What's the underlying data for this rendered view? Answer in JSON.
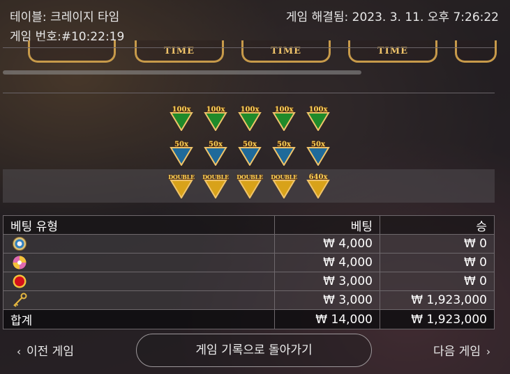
{
  "header": {
    "table_label": "테이블:",
    "table_name": "크레이지 타임",
    "game_no_label": "게임 번호:",
    "game_no": "#10:22:19",
    "resolved_label": "게임 해결됨:",
    "resolved_time": "2023. 3. 11. 오후 7:26:22"
  },
  "time_tiles": [
    "TIME",
    "TIME",
    "TIME"
  ],
  "flap_rows": [
    {
      "items": [
        {
          "label": "100x",
          "color": "#1f8a2a"
        },
        {
          "label": "100x",
          "color": "#1f8a2a"
        },
        {
          "label": "100x",
          "color": "#1f8a2a"
        },
        {
          "label": "100x",
          "color": "#1f8a2a"
        },
        {
          "label": "100x",
          "color": "#1f8a2a"
        }
      ]
    },
    {
      "items": [
        {
          "label": "50x",
          "color": "#1f6a9a"
        },
        {
          "label": "50x",
          "color": "#1f6a9a"
        },
        {
          "label": "50x",
          "color": "#1f6a9a"
        },
        {
          "label": "50x",
          "color": "#1f6a9a"
        },
        {
          "label": "50x",
          "color": "#1f6a9a"
        }
      ]
    },
    {
      "items": [
        {
          "label": "DOUBLE",
          "color": "#d8a21a"
        },
        {
          "label": "DOUBLE",
          "color": "#d8a21a"
        },
        {
          "label": "DOUBLE",
          "color": "#d8a21a"
        },
        {
          "label": "DOUBLE",
          "color": "#d8a21a"
        },
        {
          "label": "640x",
          "color": "#d8a21a"
        }
      ]
    }
  ],
  "bets_table": {
    "headers": {
      "type": "베팅 유형",
      "bet": "베팅",
      "win": "승"
    },
    "rows": [
      {
        "icon": "coin-flip-icon",
        "bet": "₩ 4,000",
        "win": "₩ 0"
      },
      {
        "icon": "pachinko-icon",
        "bet": "₩ 4,000",
        "win": "₩ 0"
      },
      {
        "icon": "cash-hunt-icon",
        "bet": "₩ 3,000",
        "win": "₩ 0"
      },
      {
        "icon": "crazy-time-key-icon",
        "bet": "₩ 3,000",
        "win": "₩ 1,923,000"
      }
    ],
    "total": {
      "label": "합계",
      "bet": "₩ 14,000",
      "win": "₩ 1,923,000"
    }
  },
  "nav": {
    "prev": "이전 게임",
    "back": "게임 기록으로 돌아가기",
    "next": "다음 게임"
  },
  "colors": {
    "gold": "#f0c46a",
    "border": "#6e686c"
  }
}
